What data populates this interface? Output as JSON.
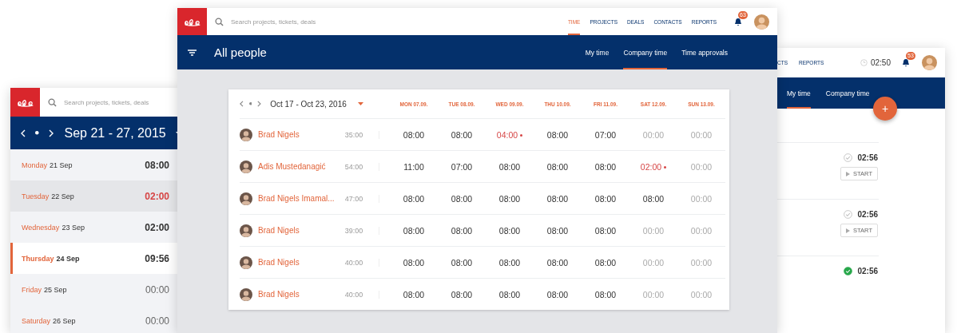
{
  "left_window": {
    "search": {
      "placeholder": "Search projects, tickets, deals"
    },
    "week": "Sep 21 - 27, 2015",
    "days": [
      {
        "day": "Monday",
        "date": "21 Sep",
        "time": "08:00",
        "kind": "normal",
        "selected": false,
        "hovered": false
      },
      {
        "day": "Tuesday",
        "date": "22 Sep",
        "time": "02:00",
        "kind": "alert",
        "selected": false,
        "hovered": true
      },
      {
        "day": "Wednesday",
        "date": "23 Sep",
        "time": "02:00",
        "kind": "normal",
        "selected": false,
        "hovered": false
      },
      {
        "day": "Thursday",
        "date": "24 Sep",
        "time": "09:56",
        "kind": "normal",
        "selected": true,
        "hovered": false
      },
      {
        "day": "Friday",
        "date": "25 Sep",
        "time": "00:00",
        "kind": "empty",
        "selected": false,
        "hovered": false
      },
      {
        "day": "Saturday",
        "date": "26 Sep",
        "time": "00:00",
        "kind": "empty",
        "selected": false,
        "hovered": false
      }
    ]
  },
  "main_window": {
    "search": {
      "placeholder": "Search projects, tickets, deals"
    },
    "nav": [
      {
        "label": "TIME",
        "selected": true
      },
      {
        "label": "PROJECTS",
        "selected": false
      },
      {
        "label": "DEALS",
        "selected": false
      },
      {
        "label": "CONTACTS",
        "selected": false
      },
      {
        "label": "REPORTS",
        "selected": false
      }
    ],
    "notifications": "63",
    "title": "All people",
    "tabs": [
      {
        "label": "My time",
        "selected": false
      },
      {
        "label": "Company time",
        "selected": true
      },
      {
        "label": "Time approvals",
        "selected": false
      }
    ],
    "table": {
      "range": "Oct 17 - Oct 23, 2016",
      "columns": [
        "MON 07.09.",
        "TUE 08.09.",
        "WED 09.09.",
        "THU 10.09.",
        "FRI 11.09.",
        "SAT 12.09.",
        "SUN 13.09."
      ],
      "rows": [
        {
          "name": "Brad Nigels",
          "total": "35:00",
          "cells": [
            {
              "value": "08:00",
              "kind": "normal"
            },
            {
              "value": "08:00",
              "kind": "normal"
            },
            {
              "value": "04:00",
              "kind": "alert"
            },
            {
              "value": "08:00",
              "kind": "normal"
            },
            {
              "value": "07:00",
              "kind": "normal"
            },
            {
              "value": "00:00",
              "kind": "empty"
            },
            {
              "value": "00:00",
              "kind": "empty"
            }
          ]
        },
        {
          "name": "Adis Mustedanagić",
          "total": "54:00",
          "cells": [
            {
              "value": "11:00",
              "kind": "normal"
            },
            {
              "value": "07:00",
              "kind": "normal"
            },
            {
              "value": "08:00",
              "kind": "normal"
            },
            {
              "value": "08:00",
              "kind": "normal"
            },
            {
              "value": "08:00",
              "kind": "normal"
            },
            {
              "value": "02:00",
              "kind": "alert"
            },
            {
              "value": "00:00",
              "kind": "empty"
            }
          ]
        },
        {
          "name": "Brad Nigels Imamal...",
          "total": "47:00",
          "cells": [
            {
              "value": "08:00",
              "kind": "normal"
            },
            {
              "value": "08:00",
              "kind": "normal"
            },
            {
              "value": "08:00",
              "kind": "normal"
            },
            {
              "value": "08:00",
              "kind": "normal"
            },
            {
              "value": "08:00",
              "kind": "normal"
            },
            {
              "value": "08:00",
              "kind": "normal"
            },
            {
              "value": "00:00",
              "kind": "empty"
            }
          ]
        },
        {
          "name": "Brad Nigels",
          "total": "39:00",
          "cells": [
            {
              "value": "08:00",
              "kind": "normal"
            },
            {
              "value": "08:00",
              "kind": "normal"
            },
            {
              "value": "08:00",
              "kind": "normal"
            },
            {
              "value": "08:00",
              "kind": "normal"
            },
            {
              "value": "08:00",
              "kind": "normal"
            },
            {
              "value": "00:00",
              "kind": "empty"
            },
            {
              "value": "00:00",
              "kind": "empty"
            }
          ]
        },
        {
          "name": "Brad Nigels",
          "total": "40:00",
          "cells": [
            {
              "value": "08:00",
              "kind": "normal"
            },
            {
              "value": "08:00",
              "kind": "normal"
            },
            {
              "value": "08:00",
              "kind": "normal"
            },
            {
              "value": "08:00",
              "kind": "normal"
            },
            {
              "value": "08:00",
              "kind": "normal"
            },
            {
              "value": "00:00",
              "kind": "empty"
            },
            {
              "value": "00:00",
              "kind": "empty"
            }
          ]
        },
        {
          "name": "Brad Nigels",
          "total": "40:00",
          "cells": [
            {
              "value": "08:00",
              "kind": "normal"
            },
            {
              "value": "08:00",
              "kind": "normal"
            },
            {
              "value": "08:00",
              "kind": "normal"
            },
            {
              "value": "08:00",
              "kind": "normal"
            },
            {
              "value": "08:00",
              "kind": "normal"
            },
            {
              "value": "00:00",
              "kind": "empty"
            },
            {
              "value": "00:00",
              "kind": "empty"
            }
          ]
        }
      ]
    }
  },
  "right_window": {
    "nav": [
      {
        "label": "CTS",
        "selected": false
      },
      {
        "label": "REPORTS",
        "selected": false
      }
    ],
    "timer": "02:50",
    "notifications": "53",
    "tabs": [
      {
        "label": "My time",
        "selected": true
      },
      {
        "label": "Company time",
        "selected": false
      }
    ],
    "add_button": "+",
    "tasks": [
      {
        "time": "02:56",
        "done": false,
        "action": "START"
      },
      {
        "time": "02:56",
        "done": false,
        "action": "START"
      },
      {
        "time": "02:56",
        "done": true
      }
    ]
  }
}
